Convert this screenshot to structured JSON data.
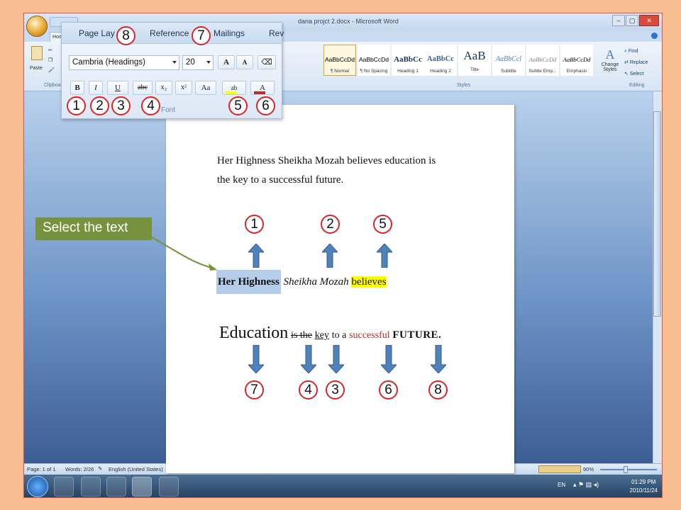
{
  "window": {
    "title": "dana projct 2.docx - Microsoft Word",
    "controls": [
      "–",
      "▢",
      "✕"
    ]
  },
  "ribbon": {
    "home_tab": "Home",
    "clipboard": {
      "paste": "Paste",
      "cut": "Cut",
      "copy": "Copy",
      "format_painter": "Format Painter",
      "group_label": "Clipboard"
    },
    "styles": [
      {
        "sample": "AaBbCcDd",
        "name": "¶ Normal"
      },
      {
        "sample": "AaBbCcDd",
        "name": "¶ No Spacing"
      },
      {
        "sample": "AaBbCc",
        "name": "Heading 1"
      },
      {
        "sample": "AaBbCc",
        "name": "Heading 2"
      },
      {
        "sample": "AaB",
        "name": "Title"
      },
      {
        "sample": "AaBbCcl",
        "name": "Subtitle"
      },
      {
        "sample": "AaBbCcDd",
        "name": "Subtle Emp..."
      },
      {
        "sample": "AaBbCcDd",
        "name": "Emphasis"
      }
    ],
    "styles_group_label": "Styles",
    "change_styles": "Change Styles",
    "editing": {
      "find": "Find",
      "replace": "Replace",
      "select": "Select",
      "group_label": "Editing"
    }
  },
  "mini_font_panel": {
    "tabs": [
      "Page Lay",
      "Reference",
      "Mailings",
      "Rev"
    ],
    "font_name": "Cambria (Headings)",
    "font_size": "20",
    "grow_font": "A",
    "shrink_font": "A",
    "bold": "B",
    "italic": "I",
    "underline": "U",
    "strikethrough": "abc",
    "subscript": "x₂",
    "superscript": "x²",
    "change_case": "Aa",
    "highlight": "ab",
    "font_color": "A",
    "group_label": "Font"
  },
  "markers": {
    "panel": [
      "8",
      "7",
      "1",
      "2",
      "3",
      "4",
      "5",
      "6"
    ],
    "up_arrows": [
      "1",
      "2",
      "5"
    ],
    "down_arrows": [
      "7",
      "4",
      "3",
      "6",
      "8"
    ]
  },
  "document": {
    "paragraph_line1": "Her Highness Sheikha Mozah believes education is",
    "paragraph_line2": "the key to a successful future.",
    "example1": {
      "bold": "Her Highness",
      "italic": "Sheikha Mozah",
      "highlight": "believes"
    },
    "example2": {
      "large": "Education",
      "strike": "is the",
      "underline": "key",
      "plain": "to a",
      "colored": "successful",
      "caps": "FUTURE."
    }
  },
  "callout": {
    "text": "Select the text"
  },
  "status": {
    "page": "Page: 1 of 1",
    "words": "Words: 2/26",
    "language": "English (United States)",
    "zoom": "90%"
  },
  "taskbar": {
    "language": "EN",
    "time": "01:29 PM",
    "date": "2010/11/24"
  },
  "colors": {
    "marker_border": "#d8262a",
    "arrow_blue": "#4f81bd",
    "callout_green": "#76923c",
    "highlight_yellow": "#ffff00",
    "font_red": "#c0282a",
    "selection_blue": "#b4cdea"
  }
}
